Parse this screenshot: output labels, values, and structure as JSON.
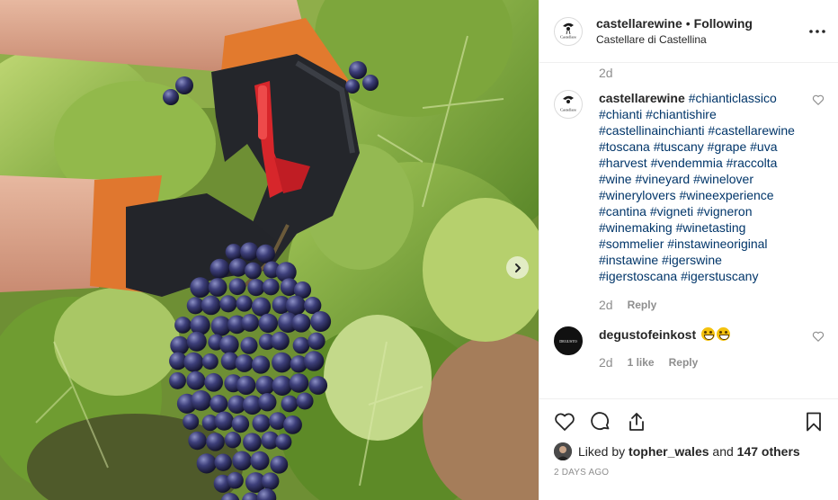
{
  "post": {
    "photo_alt": "Hands in orange and black gloves cutting a bunch of purple grapes with red shears among vine leaves",
    "next_icon": "chevron-right-icon"
  },
  "header": {
    "username": "castellarewine",
    "separator": "•",
    "follow_status": "Following",
    "location": "Castellare di Castellina",
    "avatar_label": "Castellare",
    "more_icon": "more-horizontal-icon"
  },
  "comments": {
    "top_time": "2d",
    "caption": {
      "username": "castellarewine",
      "hashtags": [
        "#chianticlassico",
        "#chianti",
        "#chiantishire",
        "#castellinainchianti",
        "#castellarewine",
        "#toscana",
        "#tuscany",
        "#grape",
        "#uva",
        "#harvest",
        "#vendemmia",
        "#raccolta",
        "#wine",
        "#vineyard",
        "#winelover",
        "#winerylovers",
        "#wineexperience",
        "#cantina",
        "#vigneti",
        "#vigneron",
        "#winemaking",
        "#winetasting",
        "#sommelier",
        "#instawineoriginal",
        "#instawine",
        "#igerswine",
        "#igerstoscana",
        "#igerstuscany"
      ],
      "time": "2d",
      "reply_label": "Reply"
    },
    "comment2": {
      "username": "degustofeinkost",
      "avatar_label": "DEGUSTO",
      "time": "2d",
      "likes": "1 like",
      "reply_label": "Reply"
    }
  },
  "actions": {
    "like_icon": "heart-icon",
    "comment_icon": "comment-icon",
    "share_icon": "share-icon",
    "save_icon": "bookmark-icon",
    "liked_by_prefix": "Liked by",
    "liked_by_user": "topher_wales",
    "liked_by_mid": "and",
    "liked_by_others": "147 others",
    "date": "2 DAYS AGO"
  },
  "colors": {
    "text": "#262626",
    "muted": "#8e8e8e",
    "hashtag": "#003569",
    "border": "#efefef"
  }
}
